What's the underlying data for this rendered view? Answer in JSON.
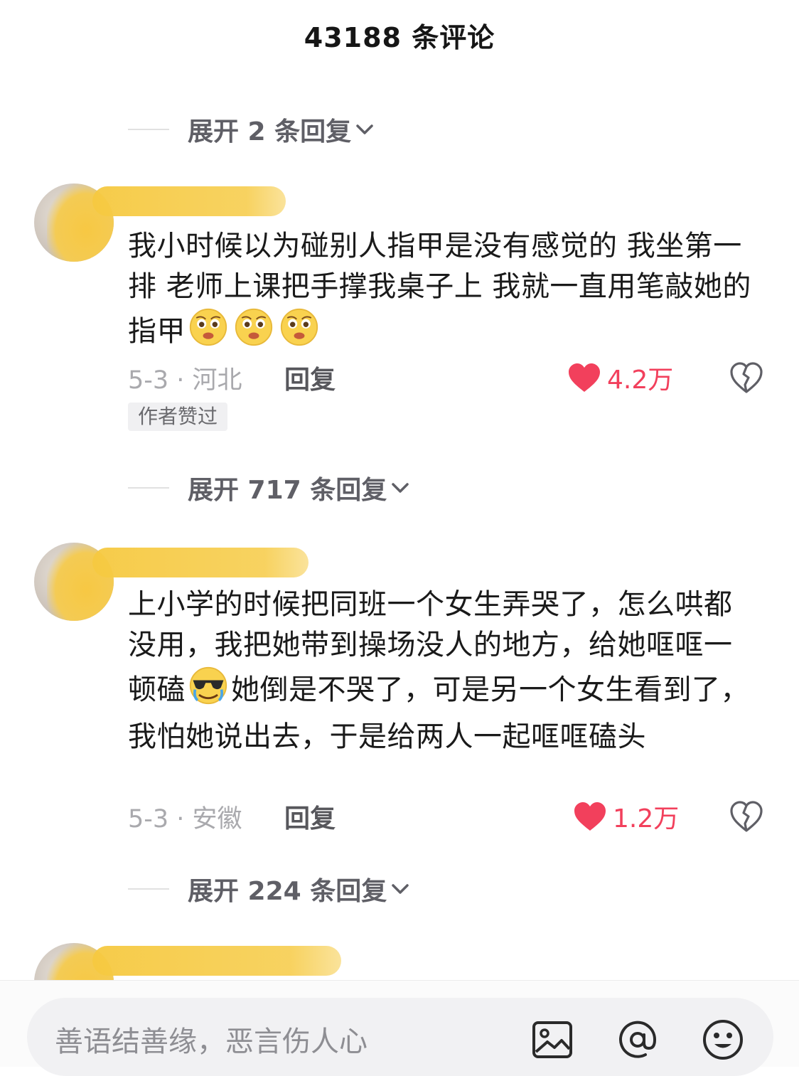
{
  "header": {
    "title": "43188 条评论"
  },
  "expand_top": {
    "text": "展开 2 条回复"
  },
  "comments": [
    {
      "text_a": "我小时候以为碰别人指甲是没有感觉的 我坐第一排 老师上课把手撑我桌子上 我就一直用笔敲她的指甲",
      "emojis": [
        "pleading-face-icon",
        "pleading-face-icon",
        "pleading-face-icon"
      ],
      "date_location": "5-3 · 河北",
      "reply_label": "回复",
      "like_count": "4.2万",
      "badge": "作者赞过",
      "expand_text": "展开 717 条回复"
    },
    {
      "text_a": "上小学的时候把同班一个女生弄哭了，怎么哄都没用，我把她带到操场没人的地方，给她哐哐一顿磕",
      "emoji_mid": "sunglasses-crying-face-icon",
      "text_b": "她倒是不哭了，可是另一个女生看到了，我怕她说出去，于是给两人一起哐哐磕头",
      "date_location": "5-3 · 安徽",
      "reply_label": "回复",
      "like_count": "1.2万",
      "expand_text": "展开 224 条回复"
    }
  ],
  "composer": {
    "placeholder": "善语结善缘，恶言伤人心",
    "icons": [
      "image-icon",
      "at-icon",
      "emoji-icon"
    ]
  },
  "colors": {
    "like": "#f2405c",
    "expand_text": "#5f5f66",
    "meta": "#a9a9ad"
  }
}
